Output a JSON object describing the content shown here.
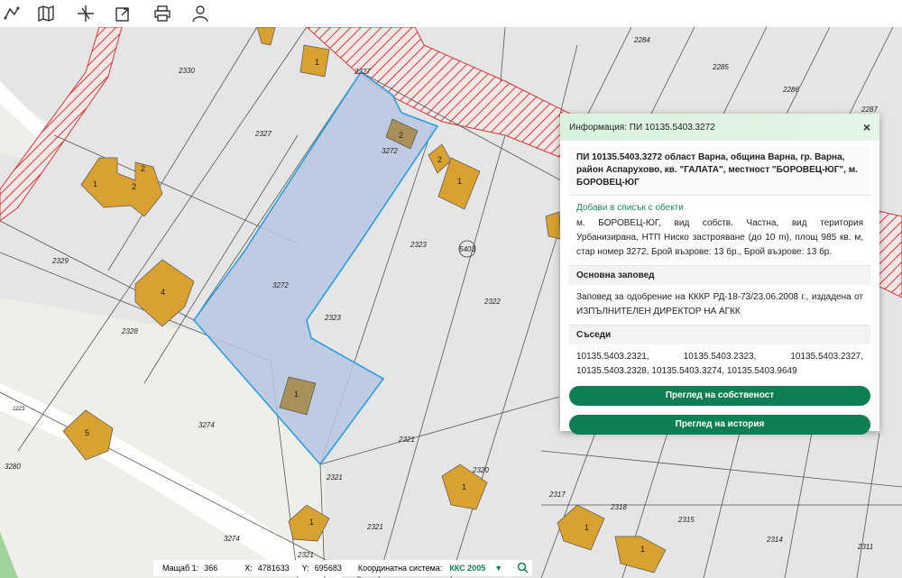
{
  "toolbar": {
    "icons": [
      "measure-icon",
      "map-icon",
      "coordinates-icon",
      "export-icon",
      "print-icon",
      "user-icon"
    ]
  },
  "map": {
    "parcels": {
      "p2284": "2284",
      "p2285": "2285",
      "p2286": "2286",
      "p2287": "2287",
      "p2330": "2330",
      "p2327": "2327",
      "p2327b": "2327",
      "p3272a": "3272",
      "p3272b": "3272",
      "p2329": "2329",
      "p2328": "2328",
      "p2323a": "2323",
      "p2323b": "2323",
      "p2322": "2322",
      "p3274a": "3274",
      "p3274b": "3274",
      "p2321a": "2321",
      "p2321b": "2321",
      "p2321c": "2321",
      "p2321d": "2321",
      "p2320": "2320",
      "p2317": "2317",
      "p2318": "2318",
      "p2315": "2315",
      "p2314": "2314",
      "p2311": "2311",
      "p3280": "3280",
      "p1223": "1223"
    },
    "block_label": "5403",
    "buildings": {
      "b1a": "1",
      "b2a": "2",
      "b2b": "2",
      "b2c": "2",
      "b1b": "1",
      "b4": "4",
      "b5": "5",
      "b1c": "1",
      "b1d": "1",
      "b1e": "1",
      "b1f": "1",
      "b1g": "1",
      "b1h": "1"
    }
  },
  "popup": {
    "title": "Информация: ПИ 10135.5403.3272",
    "close": "×",
    "heading": "ПИ 10135.5403.3272 област Варна, община Варна, гр. Варна, район Аспарухово, кв. \"ГАЛАТА\", местност \"БОРОВЕЦ-ЮГ\", м. БОРОВЕЦ-ЮГ",
    "add_link": "Добави в списък с обекти",
    "description": "м. БОРОВЕЦ-ЮГ, вид собств. Частна, вид територия Урбанизирана, НТП Ниско застрояване (до 10 m), площ 985 кв. м, стар номер 3272, Брой възрове: 13 бр., Брой възрове: 13 бр.",
    "order_title": "Основна заповед",
    "order_text": "Заповед за одобрение на КККР РД-18-73/23.06.2008 г., издадена от ИЗПЪЛНИТЕЛЕН ДИРЕКТОР НА АГКК",
    "neighbors_title": "Съседи",
    "neighbors_text": "10135.5403.2321, 10135.5403.2323, 10135.5403.2327, 10135.5403.2328, 10135.5403.3274, 10135.5403.9649",
    "btn_ownership": "Преглед на собственост",
    "btn_history": "Преглед на история"
  },
  "status": {
    "scale_label": "Мащаб 1:",
    "scale_value": "366",
    "x_label": "X:",
    "x_value": "4781633",
    "y_label": "Y:",
    "y_value": "695683",
    "crs_label": "Координатна система:",
    "crs_value": "ККС 2005"
  },
  "colors": {
    "selected_fill": "#b7c7e3",
    "selected_stroke": "#2a9ee0",
    "building": "#d9a032",
    "building_selected": "#a8905a",
    "hatch": "#d23a3a",
    "accent": "#0d7f52"
  }
}
